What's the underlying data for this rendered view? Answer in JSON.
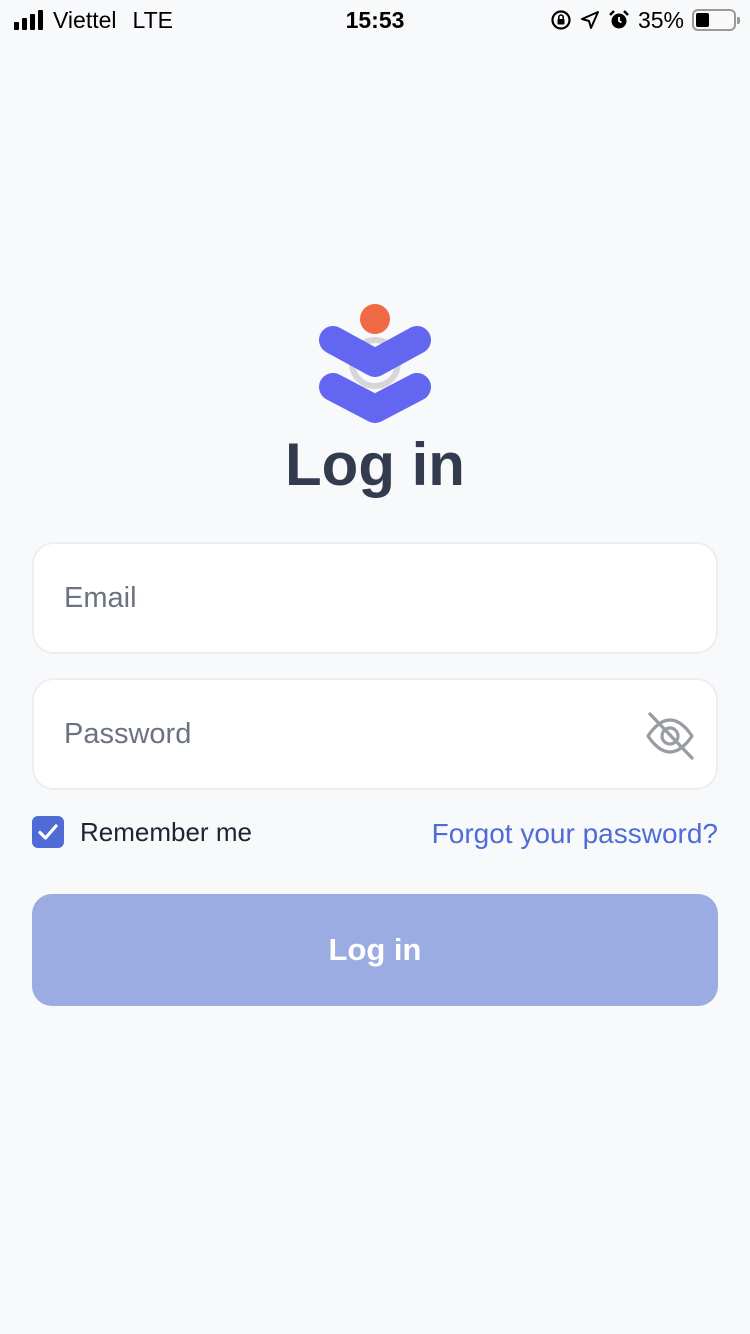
{
  "status_bar": {
    "carrier": "Viettel",
    "network": "LTE",
    "time": "15:53",
    "battery": "35%",
    "battery_level": 0.35,
    "icons": [
      "signal-icon",
      "rotation-lock-icon",
      "location-icon",
      "alarm-icon",
      "battery-icon"
    ]
  },
  "header": {
    "title": "Log in",
    "logo_icon": "app-logo-icon",
    "logo_colors": {
      "primary": "#6366f1",
      "accent": "#f06a45",
      "ring": "#d4d4d8"
    }
  },
  "form": {
    "email_placeholder": "Email",
    "email_value": "",
    "password_placeholder": "Password",
    "password_value": "",
    "password_toggle_icon": "eye-off-icon",
    "remember_label": "Remember me",
    "remember_checked": true,
    "forgot_label": "Forgot your password?",
    "submit_label": "Log in"
  },
  "colors": {
    "background": "#f8f9fb",
    "accent": "#4f6bd6",
    "button_disabled": "#9bace3",
    "title_text": "#333c4e"
  }
}
